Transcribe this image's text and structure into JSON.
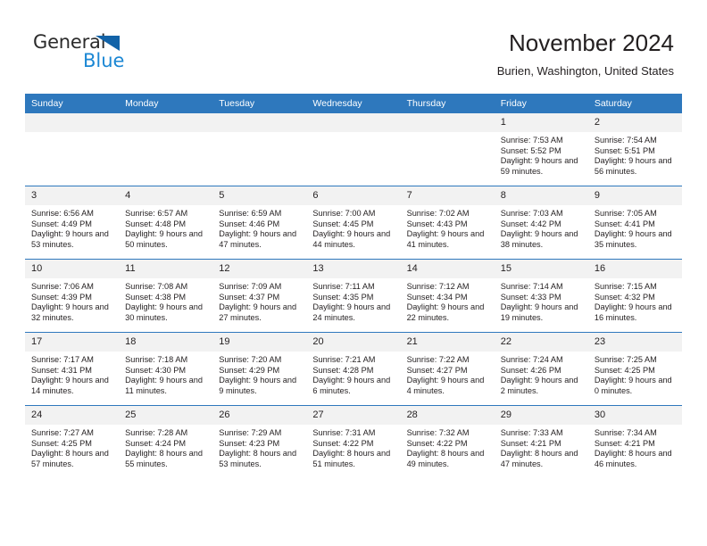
{
  "brand": {
    "name_top": "General",
    "name_bottom": "Blue",
    "triangle_color": "#1263a8",
    "blue_color": "#1b87d4"
  },
  "header": {
    "title": "November 2024",
    "subtitle": "Burien, Washington, United States"
  },
  "theme": {
    "header_bg": "#2e78bd",
    "daynum_bg": "#f2f2f2",
    "text": "#231f20"
  },
  "weekdays": [
    "Sunday",
    "Monday",
    "Tuesday",
    "Wednesday",
    "Thursday",
    "Friday",
    "Saturday"
  ],
  "labels": {
    "sunrise_prefix": "Sunrise:",
    "sunset_prefix": "Sunset:",
    "daylight_prefix": "Daylight:"
  },
  "weeks": [
    [
      {
        "day": "",
        "empty": true
      },
      {
        "day": "",
        "empty": true
      },
      {
        "day": "",
        "empty": true
      },
      {
        "day": "",
        "empty": true
      },
      {
        "day": "",
        "empty": true
      },
      {
        "day": "1",
        "sunrise": "Sunrise: 7:53 AM",
        "sunset": "Sunset: 5:52 PM",
        "daylight": "Daylight: 9 hours and 59 minutes."
      },
      {
        "day": "2",
        "sunrise": "Sunrise: 7:54 AM",
        "sunset": "Sunset: 5:51 PM",
        "daylight": "Daylight: 9 hours and 56 minutes."
      }
    ],
    [
      {
        "day": "3",
        "sunrise": "Sunrise: 6:56 AM",
        "sunset": "Sunset: 4:49 PM",
        "daylight": "Daylight: 9 hours and 53 minutes."
      },
      {
        "day": "4",
        "sunrise": "Sunrise: 6:57 AM",
        "sunset": "Sunset: 4:48 PM",
        "daylight": "Daylight: 9 hours and 50 minutes."
      },
      {
        "day": "5",
        "sunrise": "Sunrise: 6:59 AM",
        "sunset": "Sunset: 4:46 PM",
        "daylight": "Daylight: 9 hours and 47 minutes."
      },
      {
        "day": "6",
        "sunrise": "Sunrise: 7:00 AM",
        "sunset": "Sunset: 4:45 PM",
        "daylight": "Daylight: 9 hours and 44 minutes."
      },
      {
        "day": "7",
        "sunrise": "Sunrise: 7:02 AM",
        "sunset": "Sunset: 4:43 PM",
        "daylight": "Daylight: 9 hours and 41 minutes."
      },
      {
        "day": "8",
        "sunrise": "Sunrise: 7:03 AM",
        "sunset": "Sunset: 4:42 PM",
        "daylight": "Daylight: 9 hours and 38 minutes."
      },
      {
        "day": "9",
        "sunrise": "Sunrise: 7:05 AM",
        "sunset": "Sunset: 4:41 PM",
        "daylight": "Daylight: 9 hours and 35 minutes."
      }
    ],
    [
      {
        "day": "10",
        "sunrise": "Sunrise: 7:06 AM",
        "sunset": "Sunset: 4:39 PM",
        "daylight": "Daylight: 9 hours and 32 minutes."
      },
      {
        "day": "11",
        "sunrise": "Sunrise: 7:08 AM",
        "sunset": "Sunset: 4:38 PM",
        "daylight": "Daylight: 9 hours and 30 minutes."
      },
      {
        "day": "12",
        "sunrise": "Sunrise: 7:09 AM",
        "sunset": "Sunset: 4:37 PM",
        "daylight": "Daylight: 9 hours and 27 minutes."
      },
      {
        "day": "13",
        "sunrise": "Sunrise: 7:11 AM",
        "sunset": "Sunset: 4:35 PM",
        "daylight": "Daylight: 9 hours and 24 minutes."
      },
      {
        "day": "14",
        "sunrise": "Sunrise: 7:12 AM",
        "sunset": "Sunset: 4:34 PM",
        "daylight": "Daylight: 9 hours and 22 minutes."
      },
      {
        "day": "15",
        "sunrise": "Sunrise: 7:14 AM",
        "sunset": "Sunset: 4:33 PM",
        "daylight": "Daylight: 9 hours and 19 minutes."
      },
      {
        "day": "16",
        "sunrise": "Sunrise: 7:15 AM",
        "sunset": "Sunset: 4:32 PM",
        "daylight": "Daylight: 9 hours and 16 minutes."
      }
    ],
    [
      {
        "day": "17",
        "sunrise": "Sunrise: 7:17 AM",
        "sunset": "Sunset: 4:31 PM",
        "daylight": "Daylight: 9 hours and 14 minutes."
      },
      {
        "day": "18",
        "sunrise": "Sunrise: 7:18 AM",
        "sunset": "Sunset: 4:30 PM",
        "daylight": "Daylight: 9 hours and 11 minutes."
      },
      {
        "day": "19",
        "sunrise": "Sunrise: 7:20 AM",
        "sunset": "Sunset: 4:29 PM",
        "daylight": "Daylight: 9 hours and 9 minutes."
      },
      {
        "day": "20",
        "sunrise": "Sunrise: 7:21 AM",
        "sunset": "Sunset: 4:28 PM",
        "daylight": "Daylight: 9 hours and 6 minutes."
      },
      {
        "day": "21",
        "sunrise": "Sunrise: 7:22 AM",
        "sunset": "Sunset: 4:27 PM",
        "daylight": "Daylight: 9 hours and 4 minutes."
      },
      {
        "day": "22",
        "sunrise": "Sunrise: 7:24 AM",
        "sunset": "Sunset: 4:26 PM",
        "daylight": "Daylight: 9 hours and 2 minutes."
      },
      {
        "day": "23",
        "sunrise": "Sunrise: 7:25 AM",
        "sunset": "Sunset: 4:25 PM",
        "daylight": "Daylight: 9 hours and 0 minutes."
      }
    ],
    [
      {
        "day": "24",
        "sunrise": "Sunrise: 7:27 AM",
        "sunset": "Sunset: 4:25 PM",
        "daylight": "Daylight: 8 hours and 57 minutes."
      },
      {
        "day": "25",
        "sunrise": "Sunrise: 7:28 AM",
        "sunset": "Sunset: 4:24 PM",
        "daylight": "Daylight: 8 hours and 55 minutes."
      },
      {
        "day": "26",
        "sunrise": "Sunrise: 7:29 AM",
        "sunset": "Sunset: 4:23 PM",
        "daylight": "Daylight: 8 hours and 53 minutes."
      },
      {
        "day": "27",
        "sunrise": "Sunrise: 7:31 AM",
        "sunset": "Sunset: 4:22 PM",
        "daylight": "Daylight: 8 hours and 51 minutes."
      },
      {
        "day": "28",
        "sunrise": "Sunrise: 7:32 AM",
        "sunset": "Sunset: 4:22 PM",
        "daylight": "Daylight: 8 hours and 49 minutes."
      },
      {
        "day": "29",
        "sunrise": "Sunrise: 7:33 AM",
        "sunset": "Sunset: 4:21 PM",
        "daylight": "Daylight: 8 hours and 47 minutes."
      },
      {
        "day": "30",
        "sunrise": "Sunrise: 7:34 AM",
        "sunset": "Sunset: 4:21 PM",
        "daylight": "Daylight: 8 hours and 46 minutes."
      }
    ]
  ]
}
